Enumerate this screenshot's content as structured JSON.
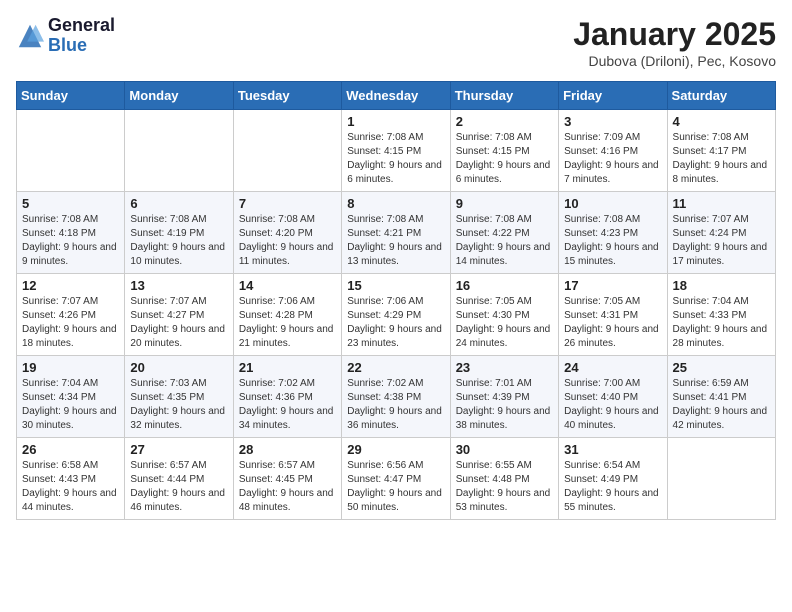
{
  "header": {
    "logo_general": "General",
    "logo_blue": "Blue",
    "month_title": "January 2025",
    "location": "Dubova (Driloni), Pec, Kosovo"
  },
  "days_of_week": [
    "Sunday",
    "Monday",
    "Tuesday",
    "Wednesday",
    "Thursday",
    "Friday",
    "Saturday"
  ],
  "weeks": [
    [
      {
        "day": "",
        "info": ""
      },
      {
        "day": "",
        "info": ""
      },
      {
        "day": "",
        "info": ""
      },
      {
        "day": "1",
        "info": "Sunrise: 7:08 AM\nSunset: 4:15 PM\nDaylight: 9 hours and 6 minutes."
      },
      {
        "day": "2",
        "info": "Sunrise: 7:08 AM\nSunset: 4:15 PM\nDaylight: 9 hours and 6 minutes."
      },
      {
        "day": "3",
        "info": "Sunrise: 7:09 AM\nSunset: 4:16 PM\nDaylight: 9 hours and 7 minutes."
      },
      {
        "day": "4",
        "info": "Sunrise: 7:08 AM\nSunset: 4:17 PM\nDaylight: 9 hours and 8 minutes."
      }
    ],
    [
      {
        "day": "5",
        "info": "Sunrise: 7:08 AM\nSunset: 4:18 PM\nDaylight: 9 hours and 9 minutes."
      },
      {
        "day": "6",
        "info": "Sunrise: 7:08 AM\nSunset: 4:19 PM\nDaylight: 9 hours and 10 minutes."
      },
      {
        "day": "7",
        "info": "Sunrise: 7:08 AM\nSunset: 4:20 PM\nDaylight: 9 hours and 11 minutes."
      },
      {
        "day": "8",
        "info": "Sunrise: 7:08 AM\nSunset: 4:21 PM\nDaylight: 9 hours and 13 minutes."
      },
      {
        "day": "9",
        "info": "Sunrise: 7:08 AM\nSunset: 4:22 PM\nDaylight: 9 hours and 14 minutes."
      },
      {
        "day": "10",
        "info": "Sunrise: 7:08 AM\nSunset: 4:23 PM\nDaylight: 9 hours and 15 minutes."
      },
      {
        "day": "11",
        "info": "Sunrise: 7:07 AM\nSunset: 4:24 PM\nDaylight: 9 hours and 17 minutes."
      }
    ],
    [
      {
        "day": "12",
        "info": "Sunrise: 7:07 AM\nSunset: 4:26 PM\nDaylight: 9 hours and 18 minutes."
      },
      {
        "day": "13",
        "info": "Sunrise: 7:07 AM\nSunset: 4:27 PM\nDaylight: 9 hours and 20 minutes."
      },
      {
        "day": "14",
        "info": "Sunrise: 7:06 AM\nSunset: 4:28 PM\nDaylight: 9 hours and 21 minutes."
      },
      {
        "day": "15",
        "info": "Sunrise: 7:06 AM\nSunset: 4:29 PM\nDaylight: 9 hours and 23 minutes."
      },
      {
        "day": "16",
        "info": "Sunrise: 7:05 AM\nSunset: 4:30 PM\nDaylight: 9 hours and 24 minutes."
      },
      {
        "day": "17",
        "info": "Sunrise: 7:05 AM\nSunset: 4:31 PM\nDaylight: 9 hours and 26 minutes."
      },
      {
        "day": "18",
        "info": "Sunrise: 7:04 AM\nSunset: 4:33 PM\nDaylight: 9 hours and 28 minutes."
      }
    ],
    [
      {
        "day": "19",
        "info": "Sunrise: 7:04 AM\nSunset: 4:34 PM\nDaylight: 9 hours and 30 minutes."
      },
      {
        "day": "20",
        "info": "Sunrise: 7:03 AM\nSunset: 4:35 PM\nDaylight: 9 hours and 32 minutes."
      },
      {
        "day": "21",
        "info": "Sunrise: 7:02 AM\nSunset: 4:36 PM\nDaylight: 9 hours and 34 minutes."
      },
      {
        "day": "22",
        "info": "Sunrise: 7:02 AM\nSunset: 4:38 PM\nDaylight: 9 hours and 36 minutes."
      },
      {
        "day": "23",
        "info": "Sunrise: 7:01 AM\nSunset: 4:39 PM\nDaylight: 9 hours and 38 minutes."
      },
      {
        "day": "24",
        "info": "Sunrise: 7:00 AM\nSunset: 4:40 PM\nDaylight: 9 hours and 40 minutes."
      },
      {
        "day": "25",
        "info": "Sunrise: 6:59 AM\nSunset: 4:41 PM\nDaylight: 9 hours and 42 minutes."
      }
    ],
    [
      {
        "day": "26",
        "info": "Sunrise: 6:58 AM\nSunset: 4:43 PM\nDaylight: 9 hours and 44 minutes."
      },
      {
        "day": "27",
        "info": "Sunrise: 6:57 AM\nSunset: 4:44 PM\nDaylight: 9 hours and 46 minutes."
      },
      {
        "day": "28",
        "info": "Sunrise: 6:57 AM\nSunset: 4:45 PM\nDaylight: 9 hours and 48 minutes."
      },
      {
        "day": "29",
        "info": "Sunrise: 6:56 AM\nSunset: 4:47 PM\nDaylight: 9 hours and 50 minutes."
      },
      {
        "day": "30",
        "info": "Sunrise: 6:55 AM\nSunset: 4:48 PM\nDaylight: 9 hours and 53 minutes."
      },
      {
        "day": "31",
        "info": "Sunrise: 6:54 AM\nSunset: 4:49 PM\nDaylight: 9 hours and 55 minutes."
      },
      {
        "day": "",
        "info": ""
      }
    ]
  ]
}
